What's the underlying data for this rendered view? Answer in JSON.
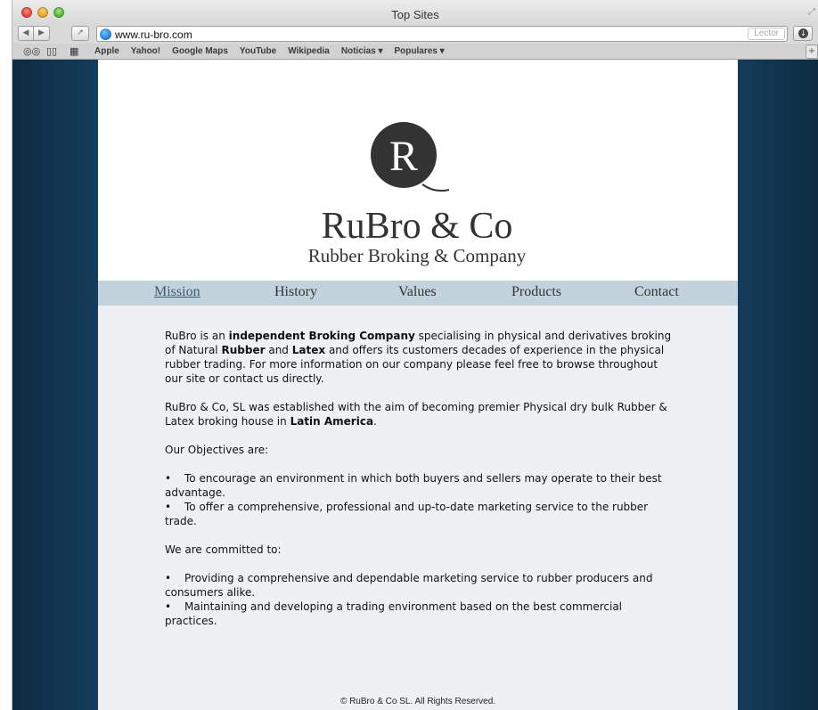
{
  "window": {
    "title": "Top Sites"
  },
  "toolbar": {
    "url": "www.ru-bro.com",
    "reader_label": "Lector"
  },
  "bookmarks": [
    "Apple",
    "Yahoo!",
    "Google Maps",
    "YouTube",
    "Wikipedia",
    "Noticias ▾",
    "Populares ▾"
  ],
  "site": {
    "logo": {
      "monogram": "R",
      "name": "RuBro & Co",
      "tagline": "Rubber Broking & Company"
    },
    "nav": [
      "Mission",
      "History",
      "Values",
      "Products",
      "Contact"
    ],
    "intro": {
      "p1": "RuBro is an",
      "b1": "independent Broking Company",
      "p2": "specialising in physical and derivatives broking of Natural",
      "b2": "Rubber",
      "p3": "and",
      "b3": "Latex",
      "p4": "and offers its customers decades of experience in the physical rubber trading. For more information on our company please feel free to browse throughout our site or contact us directly."
    },
    "established": {
      "p1": "RuBro & Co, SL was established with the aim of becoming premier Physical dry bulk Rubber & Latex broking house in",
      "b1": "Latin America",
      "p2": "."
    },
    "objectives_heading": "Our Objectives are:",
    "objectives": [
      "To encourage an environment in which both buyers and sellers may operate to their best advantage.",
      "To offer a comprehensive, professional and up-to-date marketing service to the rubber trade."
    ],
    "committed_heading": "We are committed to:",
    "commitments": [
      "Providing a comprehensive and dependable marketing service to rubber producers and consumers alike.",
      "Maintaining and developing a trading environment based on the best commercial practices."
    ],
    "bullet": "•",
    "footer": "© RuBro & Co SL. All Rights Reserved."
  },
  "colors": {
    "nav_band": "#c3d3de",
    "content_bg": "#edf1f3",
    "page_side": "#1c4d72",
    "logo_dark": "#333333"
  }
}
